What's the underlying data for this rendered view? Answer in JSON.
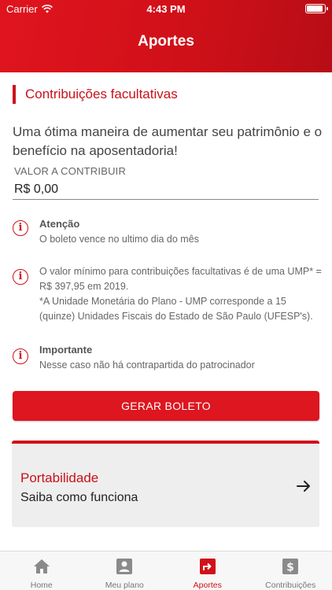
{
  "status_bar": {
    "carrier": "Carrier",
    "time": "4:43 PM"
  },
  "header": {
    "title": "Aportes"
  },
  "section": {
    "title": "Contribuições facultativas"
  },
  "intro": "Uma ótima maneira de aumentar seu patrimônio e o benefício na aposentadoria!",
  "field": {
    "label": "VALOR A CONTRIBUIR",
    "value": "R$ 0,00"
  },
  "notices": [
    {
      "title": "Atenção",
      "text": "O boleto vence no ultimo dia do mês"
    },
    {
      "title": "",
      "text": "O valor mínimo para contribuições facultativas é de uma UMP* = R$ 397,95 em 2019.",
      "note": "*A Unidade Monetária do Plano - UMP corresponde a 15 (quinze) Unidades Fiscais do Estado de São Paulo (UFESP's)."
    },
    {
      "title": "Importante",
      "text": "Nesse caso não há contrapartida do patrocinador"
    }
  ],
  "button": {
    "label": "GERAR BOLETO"
  },
  "portabilidade": {
    "title": "Portabilidade",
    "subtitle": "Saiba como funciona"
  },
  "tabs": [
    {
      "label": "Home",
      "icon": "home-icon"
    },
    {
      "label": "Meu plano",
      "icon": "user-card-icon"
    },
    {
      "label": "Aportes",
      "icon": "share-arrow-icon"
    },
    {
      "label": "Contribuições",
      "icon": "dollar-icon"
    }
  ],
  "active_tab": "Aportes",
  "colors": {
    "brand": "#d0101a",
    "header_start": "#e0141e",
    "header_end": "#b70d16"
  }
}
